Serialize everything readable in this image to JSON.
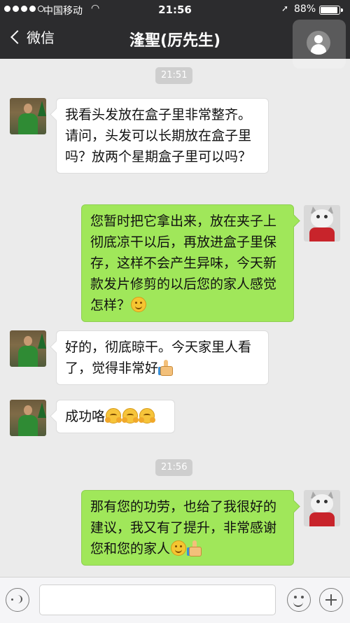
{
  "status_bar": {
    "carrier": "中国移动",
    "time": "21:56",
    "battery": "88%",
    "battery_level": 0.88
  },
  "nav": {
    "back_label": "微信",
    "title": "湰聖(厉先生)"
  },
  "messages": [
    {
      "type": "timestamp",
      "text": "21:51"
    },
    {
      "side": "in",
      "text": "我看头发放在盒子里非常整齐。请问，头发可以长期放在盒子里吗？放两个星期盒子里可以吗？"
    },
    {
      "side": "out",
      "text": "您暂时把它拿出来，放在夹子上彻底凉干以后，再放进盒子里保存，这样不会产生异味，今天新款发片修剪的以后您的家人感觉怎样？",
      "emojis": [
        "smile"
      ]
    },
    {
      "side": "in",
      "text": "好的，彻底晾干。今天家里人看了，觉得非常好",
      "emojis": [
        "thumbs-up"
      ]
    },
    {
      "side": "in",
      "text": "成功咯",
      "emojis": [
        "hug",
        "hug",
        "hug"
      ]
    },
    {
      "type": "timestamp",
      "text": "21:56"
    },
    {
      "side": "out",
      "text": "那有您的功劳，也给了我很好的建议，我又有了提升，非常感谢您和您的家人",
      "emojis": [
        "smile",
        "thumbs-up"
      ]
    }
  ],
  "colors": {
    "nav_bg": "#2c2c2e",
    "chat_bg": "#ebebeb",
    "outgoing_bubble": "#a0e75a",
    "incoming_bubble": "#ffffff"
  }
}
